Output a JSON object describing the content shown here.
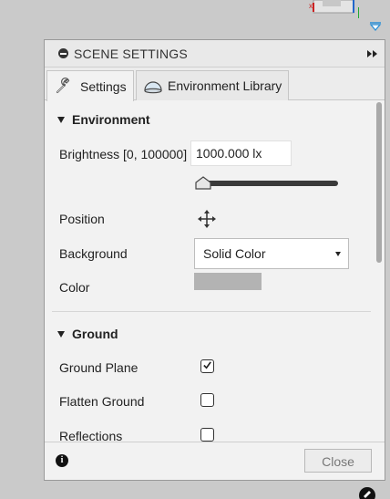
{
  "panel": {
    "title": "SCENE SETTINGS"
  },
  "tabs": [
    {
      "label": "Settings",
      "icon": "wrench-icon",
      "active": true
    },
    {
      "label": "Environment Library",
      "icon": "dome-icon",
      "active": false
    }
  ],
  "environment": {
    "heading": "Environment",
    "brightness_label": "Brightness [0, 100000]",
    "brightness_value": "1000.000 lx",
    "brightness_fraction": 0.01,
    "position_label": "Position",
    "background_label": "Background",
    "background_value": "Solid Color",
    "color_label": "Color",
    "color_value": "#b3b3b3"
  },
  "ground": {
    "heading": "Ground",
    "ground_plane_label": "Ground Plane",
    "ground_plane_checked": true,
    "flatten_ground_label": "Flatten Ground",
    "flatten_ground_checked": false,
    "reflections_label": "Reflections",
    "reflections_checked": false
  },
  "footer": {
    "close_label": "Close"
  },
  "colors": {
    "panel_bg": "#f2f2f2",
    "canvas_bg": "#cacaca",
    "accent_blue": "#2a8fd6"
  }
}
